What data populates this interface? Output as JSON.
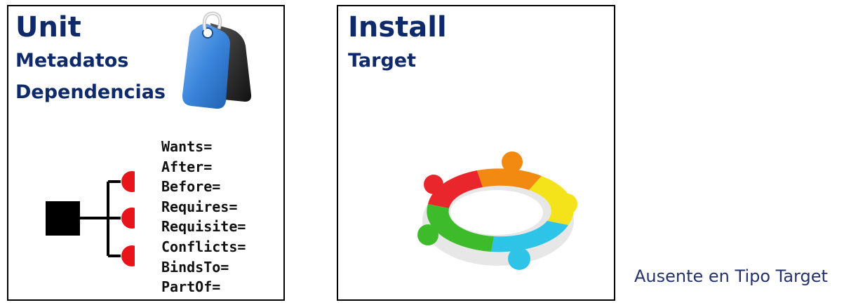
{
  "unit": {
    "title": "Unit",
    "subtitles": [
      "Metadatos",
      "Dependencias"
    ],
    "directives": [
      "Wants=",
      "After=",
      "Before=",
      "Requires=",
      "Requisite=",
      "Conflicts=",
      "BindsTo=",
      "PartOf="
    ],
    "icon": "tag-icon"
  },
  "install": {
    "title": "Install",
    "subtitle": "Target",
    "icon": "team-puzzle-ring-icon"
  },
  "caption": "Ausente en Tipo Target",
  "colors": {
    "heading": "#0f2a6b",
    "caption": "#26336b",
    "node": "#e8141c",
    "puzzle": [
      "#e8262b",
      "#f28a12",
      "#f4e21a",
      "#2ec4e8",
      "#3dbb2b"
    ]
  }
}
